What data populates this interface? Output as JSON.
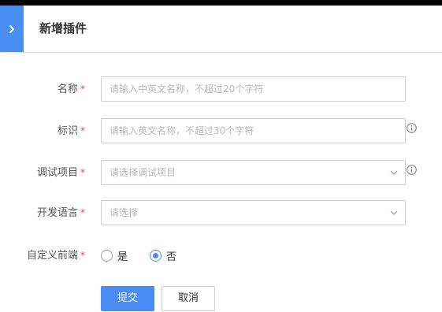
{
  "header": {
    "title": "新增插件",
    "collapse_icon": "chevron-right-icon"
  },
  "form": {
    "name": {
      "label": "名称",
      "placeholder": "请输入中英文名称，不超过20个字符",
      "value": ""
    },
    "identifier": {
      "label": "标识",
      "placeholder": "请输入英文名称，不超过30个字符",
      "value": ""
    },
    "project": {
      "label": "调试项目",
      "placeholder": "请选择调试项目"
    },
    "language": {
      "label": "开发语言",
      "placeholder": "请选择"
    },
    "custom_frontend": {
      "label": "自定义前端",
      "options": [
        {
          "label": "是",
          "checked": false
        },
        {
          "label": "否",
          "checked": true
        }
      ]
    },
    "required_mark": "*"
  },
  "actions": {
    "submit_label": "提交",
    "cancel_label": "取消"
  },
  "colors": {
    "accent": "#4a8bf5",
    "required": "#e5484d"
  }
}
